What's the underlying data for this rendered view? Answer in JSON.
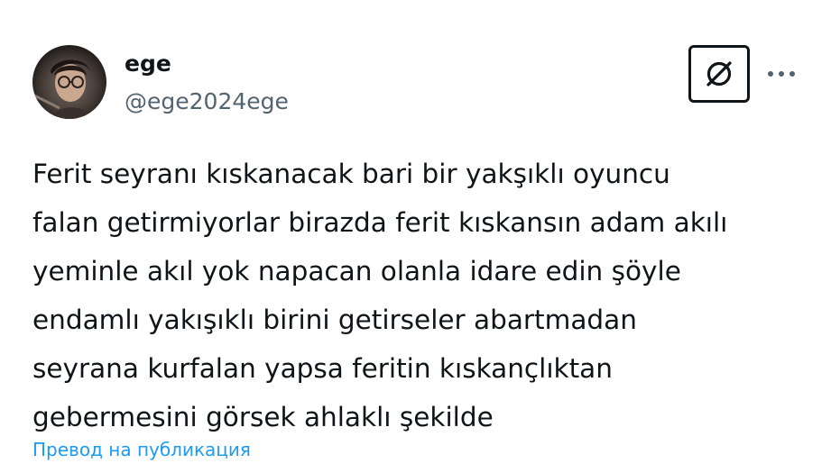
{
  "post": {
    "author": {
      "display_name": "ege",
      "handle": "@ege2024ege",
      "avatar_icon": "profile-photo-avatar"
    },
    "actions": {
      "grok_icon": "grok-icon",
      "more_icon": "more-horizontal-icon"
    },
    "text_lines": [
      "Ferit seyranı kıskanacak bari bir yakşıklı oyuncu",
      "falan getirmiyorlar birazda ferit kıskansın adam akılı",
      "yeminle akıl yok napacan olanla idare edin şöyle",
      "endamlı yakışıklı birini getirseler abartmadan",
      "seyrana kurfalan yapsa feritin kıskançlıktan",
      "gebermesini görsek ahlaklı şekilde"
    ],
    "translate_label": "Превод на публикация"
  },
  "colors": {
    "text_primary": "#0f1419",
    "text_secondary": "#536471",
    "link": "#1d9bf0",
    "background": "#ffffff"
  }
}
